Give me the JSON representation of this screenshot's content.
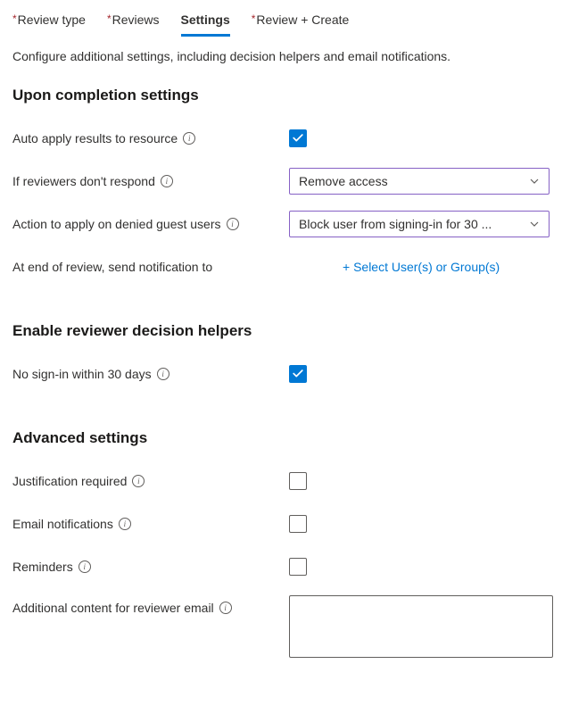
{
  "tabs": {
    "review_type": "Review type",
    "reviews": "Reviews",
    "settings": "Settings",
    "review_create": "Review + Create"
  },
  "description": "Configure additional settings, including decision helpers and email notifications.",
  "sections": {
    "completion": {
      "title": "Upon completion settings",
      "auto_apply": {
        "label": "Auto apply results to resource",
        "checked": true
      },
      "no_respond": {
        "label": "If reviewers don't respond",
        "value": "Remove access"
      },
      "denied_guest": {
        "label": "Action to apply on denied guest users",
        "value": "Block user from signing-in for 30 ..."
      },
      "notify": {
        "label": "At end of review, send notification to",
        "action": "+ Select User(s) or Group(s)"
      }
    },
    "helpers": {
      "title": "Enable reviewer decision helpers",
      "no_signin": {
        "label": "No sign-in within 30 days",
        "checked": true
      }
    },
    "advanced": {
      "title": "Advanced settings",
      "justification": {
        "label": "Justification required",
        "checked": false
      },
      "email": {
        "label": "Email notifications",
        "checked": false
      },
      "reminders": {
        "label": "Reminders",
        "checked": false
      },
      "additional": {
        "label": "Additional content for reviewer email",
        "value": ""
      }
    }
  }
}
